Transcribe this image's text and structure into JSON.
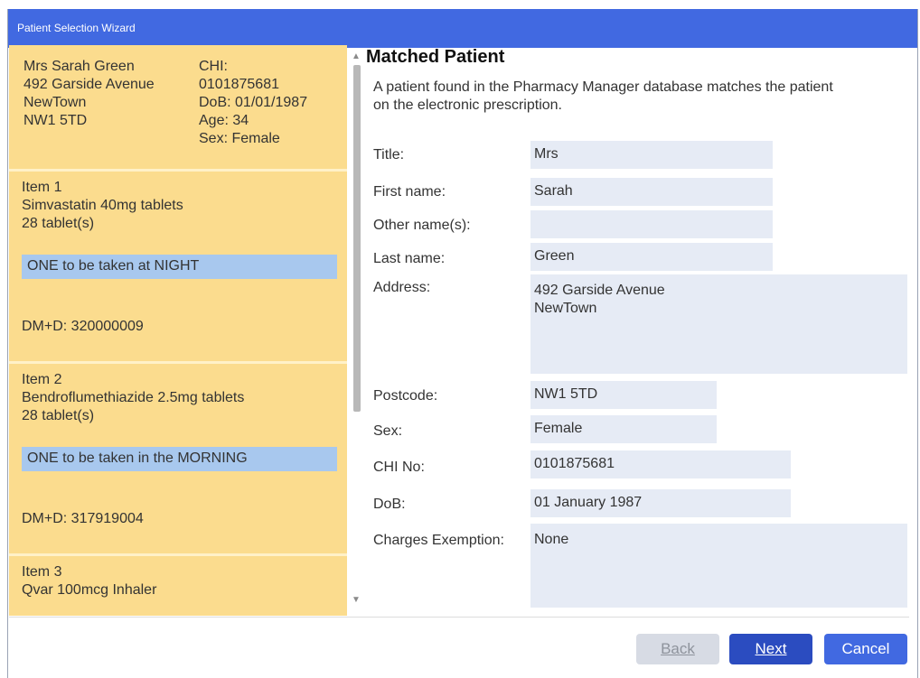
{
  "window": {
    "title": "Patient Selection Wizard"
  },
  "patient_card": {
    "name": "Mrs Sarah Green",
    "address1": "492 Garside Avenue",
    "address2": "NewTown",
    "postcode": "NW1 5TD",
    "chi_label": "CHI:",
    "chi_value": "0101875681",
    "dob": "DoB: 01/01/1987",
    "age": "Age: 34",
    "sex": "Sex: Female"
  },
  "items": [
    {
      "header": "Item 1",
      "drug": "Simvastatin 40mg tablets",
      "quantity": "28  tablet(s)",
      "dosage": "ONE to be taken at NIGHT",
      "dmd": "DM+D: 320000009"
    },
    {
      "header": "Item 2",
      "drug": "Bendroflumethiazide 2.5mg tablets",
      "quantity": "28  tablet(s)",
      "dosage": "ONE to be taken in the MORNING",
      "dmd": "DM+D: 317919004"
    },
    {
      "header": "Item 3",
      "drug": "Qvar 100mcg Inhaler"
    }
  ],
  "form": {
    "heading": "Matched Patient",
    "description": "A patient found in the Pharmacy Manager database matches the patient on the electronic prescription.",
    "title_label": "Title:",
    "title_value": "Mrs",
    "first_name_label": "First name:",
    "first_name_value": "Sarah",
    "other_names_label": "Other name(s):",
    "other_names_value": "",
    "last_name_label": "Last name:",
    "last_name_value": "Green",
    "address_label": "Address:",
    "address_line1": "492 Garside Avenue",
    "address_line2": "NewTown",
    "postcode_label": "Postcode:",
    "postcode_value": "NW1 5TD",
    "sex_label": "Sex:",
    "sex_value": "Female",
    "chi_label": "CHI No:",
    "chi_value": "0101875681",
    "dob_label": "DoB:",
    "dob_value": "01 January 1987",
    "exemption_label": "Charges Exemption:",
    "exemption_value": "None"
  },
  "buttons": {
    "back": "Back",
    "next": "Next",
    "cancel": "Cancel"
  },
  "colors": {
    "titlebar": "#4169e1",
    "panel": "#fbdc8e",
    "dosage_highlight": "#a8c8ee",
    "field_bg": "#e6ebf5",
    "next_button": "#2b4cc0"
  }
}
